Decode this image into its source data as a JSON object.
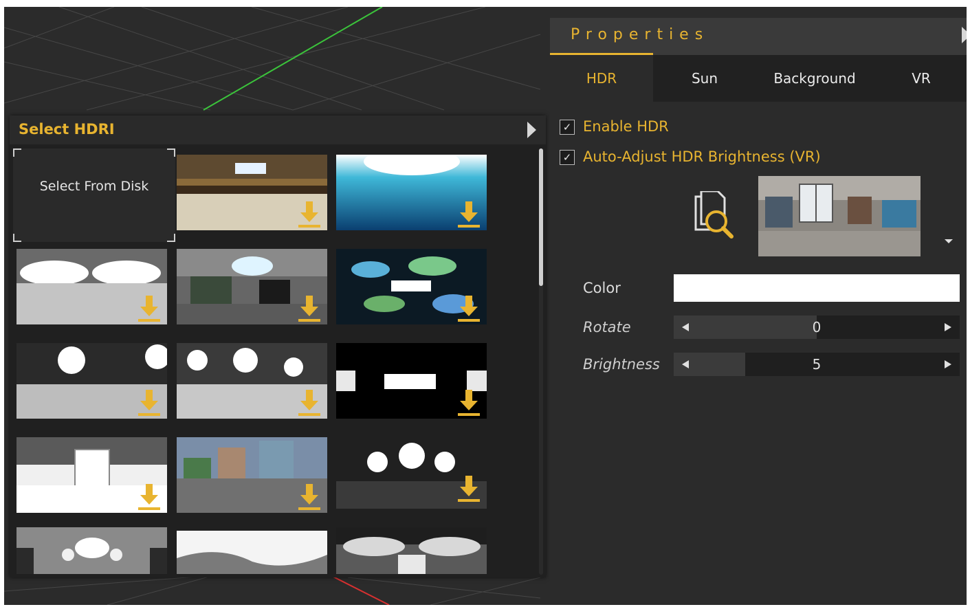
{
  "hdri_panel": {
    "title": "Select HDRI",
    "select_from_disk": "Select From Disk",
    "thumbnails": [
      {
        "id": "hall"
      },
      {
        "id": "blue-sky"
      },
      {
        "id": "lamps-grey"
      },
      {
        "id": "office"
      },
      {
        "id": "color-blur"
      },
      {
        "id": "softbox-grey"
      },
      {
        "id": "softbox-grey-2"
      },
      {
        "id": "studio-black"
      },
      {
        "id": "window-white"
      },
      {
        "id": "city-plaza"
      },
      {
        "id": "three-lights"
      },
      {
        "id": "room-lights"
      },
      {
        "id": "white-dome"
      },
      {
        "id": "atrium"
      }
    ]
  },
  "properties": {
    "title": "Properties",
    "tabs": [
      {
        "label": "HDR",
        "active": true
      },
      {
        "label": "Sun",
        "active": false
      },
      {
        "label": "Background",
        "active": false
      },
      {
        "label": "VR",
        "active": false
      }
    ],
    "enable_hdr": {
      "label": "Enable HDR",
      "checked": true
    },
    "auto_adjust": {
      "label": "Auto-Adjust HDR Brightness (VR)",
      "checked": true
    },
    "color": {
      "label": "Color",
      "value": "#ffffff"
    },
    "rotate": {
      "label": "Rotate",
      "value": "0",
      "fraction": 0.5
    },
    "brightness": {
      "label": "Brightness",
      "value": "5",
      "fraction": 0.25
    }
  },
  "colors": {
    "accent": "#e8b430",
    "panel": "#2b2b2b",
    "header": "#3a3a3a"
  }
}
